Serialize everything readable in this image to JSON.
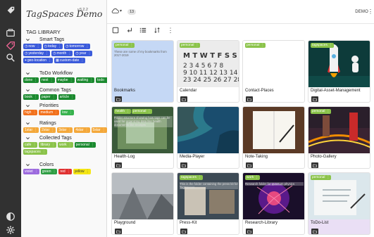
{
  "app": {
    "title": "TagSpaces Demo",
    "version": "v3.2.2"
  },
  "library": {
    "title": "TAG LIBRARY",
    "groups": [
      {
        "name": "Smart Tags",
        "rows": [
          [
            {
              "label": "now",
              "color": "#3b5bdb",
              "icon": "clock-icon"
            },
            {
              "label": "today",
              "color": "#3b5bdb",
              "icon": "clock-icon"
            },
            {
              "label": "tomorrow",
              "color": "#3b5bdb",
              "icon": "clock-icon"
            }
          ],
          [
            {
              "label": "yesterday",
              "color": "#3b5bdb",
              "icon": "clock-icon"
            },
            {
              "label": "month",
              "color": "#3b5bdb",
              "icon": "clock-icon"
            },
            {
              "label": "year",
              "color": "#3b5bdb",
              "icon": "clock-icon"
            }
          ],
          [
            {
              "label": "geo-location",
              "color": "#3b5bdb",
              "icon": "pin-icon"
            },
            {
              "label": "custom-date",
              "color": "#3b5bdb",
              "icon": "calendar-icon"
            }
          ]
        ]
      },
      {
        "name": "ToDo Workflow",
        "rows": [
          [
            {
              "label": "done",
              "color": "#1b8a2f"
            },
            {
              "label": "next",
              "color": "#1b8a2f"
            },
            {
              "label": "maybe",
              "color": "#1b8a2f"
            },
            {
              "label": "waiting",
              "color": "#1b8a2f"
            },
            {
              "label": "todo",
              "color": "#1b8a2f"
            }
          ]
        ]
      },
      {
        "name": "Common Tags",
        "rows": [
          [
            {
              "label": "book",
              "color": "#1b8a2f"
            },
            {
              "label": "paper",
              "color": "#1b8a2f"
            },
            {
              "label": "article",
              "color": "#1b8a2f"
            }
          ]
        ]
      },
      {
        "name": "Priorities",
        "rows": [
          [
            {
              "label": "high",
              "color": "#f2711c"
            },
            {
              "label": "medium",
              "color": "#f2711c"
            },
            {
              "label": "low",
              "color": "#37b24d"
            }
          ]
        ]
      },
      {
        "name": "Ratings",
        "rows": [
          [
            {
              "label": "1star",
              "color": "#f4a83a"
            },
            {
              "label": "2star",
              "color": "#f4a83a"
            },
            {
              "label": "3star",
              "color": "#f4a83a"
            },
            {
              "label": "4star",
              "color": "#f4a83a"
            },
            {
              "label": "5star",
              "color": "#f4a83a"
            }
          ]
        ]
      },
      {
        "name": "Collected Tags",
        "rows": [
          [
            {
              "label": "cafe",
              "color": "#8bc34a"
            },
            {
              "label": "library",
              "color": "#8bc34a"
            },
            {
              "label": "work",
              "color": "#8bc34a"
            },
            {
              "label": "personal",
              "color": "#1b8a2f"
            }
          ],
          [
            {
              "label": "tagspaces",
              "color": "#8bc34a"
            }
          ]
        ]
      },
      {
        "name": "Colors",
        "rows": [
          [
            {
              "label": "violet",
              "color": "#9c6ade"
            },
            {
              "label": "green",
              "color": "#2f9e44"
            },
            {
              "label": "red",
              "color": "#e03131"
            },
            {
              "label": "yellow",
              "color": "#f5e614",
              "text_color": "#333333"
            }
          ]
        ]
      }
    ]
  },
  "topbar": {
    "file_count": "13",
    "location": "DEMO"
  },
  "files": [
    {
      "name": "Bookmarks",
      "tags": [
        {
          "label": "personal",
          "color": "#8bc34a"
        }
      ],
      "description": "These are some of my bookmarks from 2017-2019",
      "thumb": "bookmarks"
    },
    {
      "name": "Calendar",
      "tags": [
        {
          "label": "personal",
          "color": "#8bc34a"
        }
      ],
      "description": "",
      "thumb": "calendar"
    },
    {
      "name": "Contact-Places",
      "tags": [
        {
          "label": "personal",
          "color": "#8bc34a"
        }
      ],
      "description": "",
      "thumb": "blank"
    },
    {
      "name": "Digital-Asset-Management",
      "tags": [
        {
          "label": "tagspaces",
          "color": "#8bc34a"
        }
      ],
      "description": "",
      "thumb": "rocket"
    },
    {
      "name": "Health-Log",
      "tags": [
        {
          "label": "health",
          "color": "#8bc34a"
        },
        {
          "label": "personal",
          "color": "#8bc34a"
        }
      ],
      "description": "Folder structure showing how tags can be used for organizing data like health documents like receipts",
      "thumb": "health"
    },
    {
      "name": "Media-Player",
      "tags": [],
      "description": "",
      "thumb": "coast"
    },
    {
      "name": "Note-Taking",
      "tags": [],
      "description": "",
      "thumb": "notebook"
    },
    {
      "name": "Photo-Gallery",
      "tags": [
        {
          "label": "personal",
          "color": "#8bc34a"
        }
      ],
      "description": "",
      "thumb": "london"
    },
    {
      "name": "Playground",
      "tags": [],
      "description": "",
      "thumb": "playground"
    },
    {
      "name": "Press-Kit",
      "tags": [
        {
          "label": "tagspaces",
          "color": "#8bc34a"
        }
      ],
      "description": "This is the folder containing the press kit for TagSpaces",
      "thumb": "press"
    },
    {
      "name": "Research-Library",
      "tags": [
        {
          "label": "work",
          "color": "#8bc34a"
        }
      ],
      "description": "Research folder for quantum physics",
      "thumb": "plasma"
    },
    {
      "name": "ToDo-List",
      "tags": [
        {
          "label": "personal",
          "color": "#8bc34a"
        }
      ],
      "description": "",
      "thumb": "writing"
    }
  ]
}
